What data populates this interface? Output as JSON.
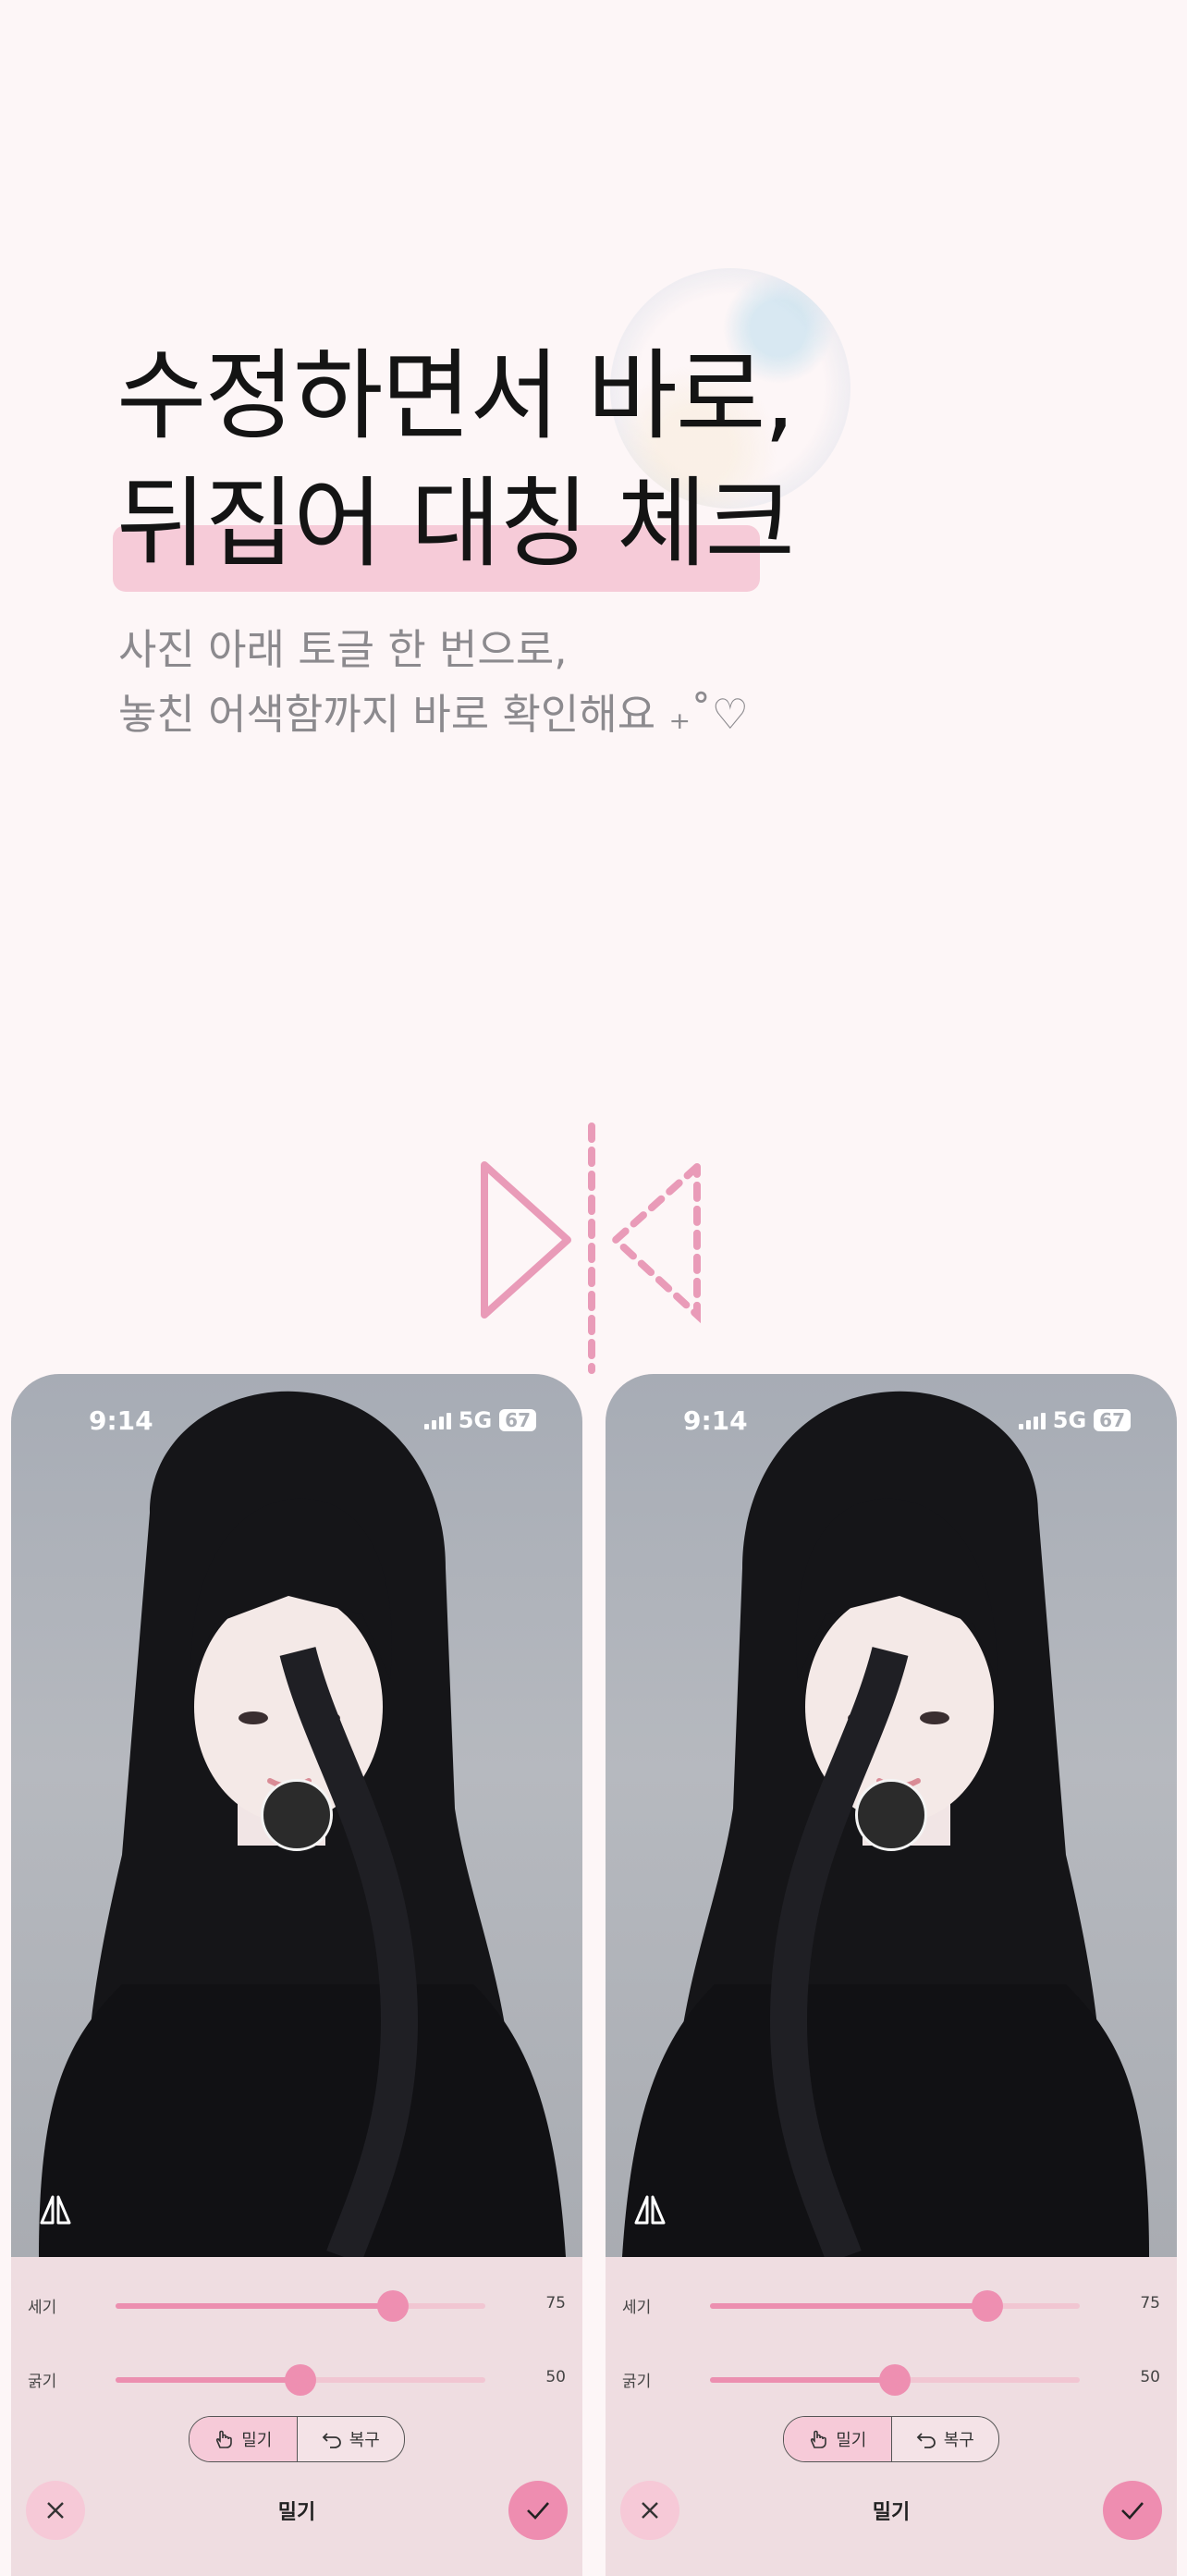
{
  "headline": {
    "line1": "수정하면서 바로,",
    "line2": "뒤집어 대칭 체크"
  },
  "subtitle": {
    "line1": "사진 아래 토글 한 번으로,",
    "line2": "놓친 어색함까지 바로 확인해요 ₊˚♡"
  },
  "colors": {
    "accent": "#ee8fb1",
    "background": "#fdf6f7",
    "highlight": "#f6cbd8",
    "panel": "#efdde1"
  },
  "phones": [
    {
      "status": {
        "time": "9:14",
        "network": "5G",
        "battery": "67"
      },
      "sliders": [
        {
          "label": "세기",
          "value": "75",
          "level": 0.75
        },
        {
          "label": "굵기",
          "value": "50",
          "level": 0.5
        }
      ],
      "tool_options": {
        "push": "밀기",
        "restore": "복구"
      },
      "mode_title": "밀기"
    },
    {
      "status": {
        "time": "9:14",
        "network": "5G",
        "battery": "67"
      },
      "sliders": [
        {
          "label": "세기",
          "value": "75",
          "level": 0.75
        },
        {
          "label": "굵기",
          "value": "50",
          "level": 0.5
        }
      ],
      "tool_options": {
        "push": "밀기",
        "restore": "복구"
      },
      "mode_title": "밀기"
    }
  ],
  "icons": [
    "mirror-symmetry-icon",
    "flip-icon",
    "hand-icon",
    "undo-icon",
    "close-icon",
    "check-icon"
  ]
}
